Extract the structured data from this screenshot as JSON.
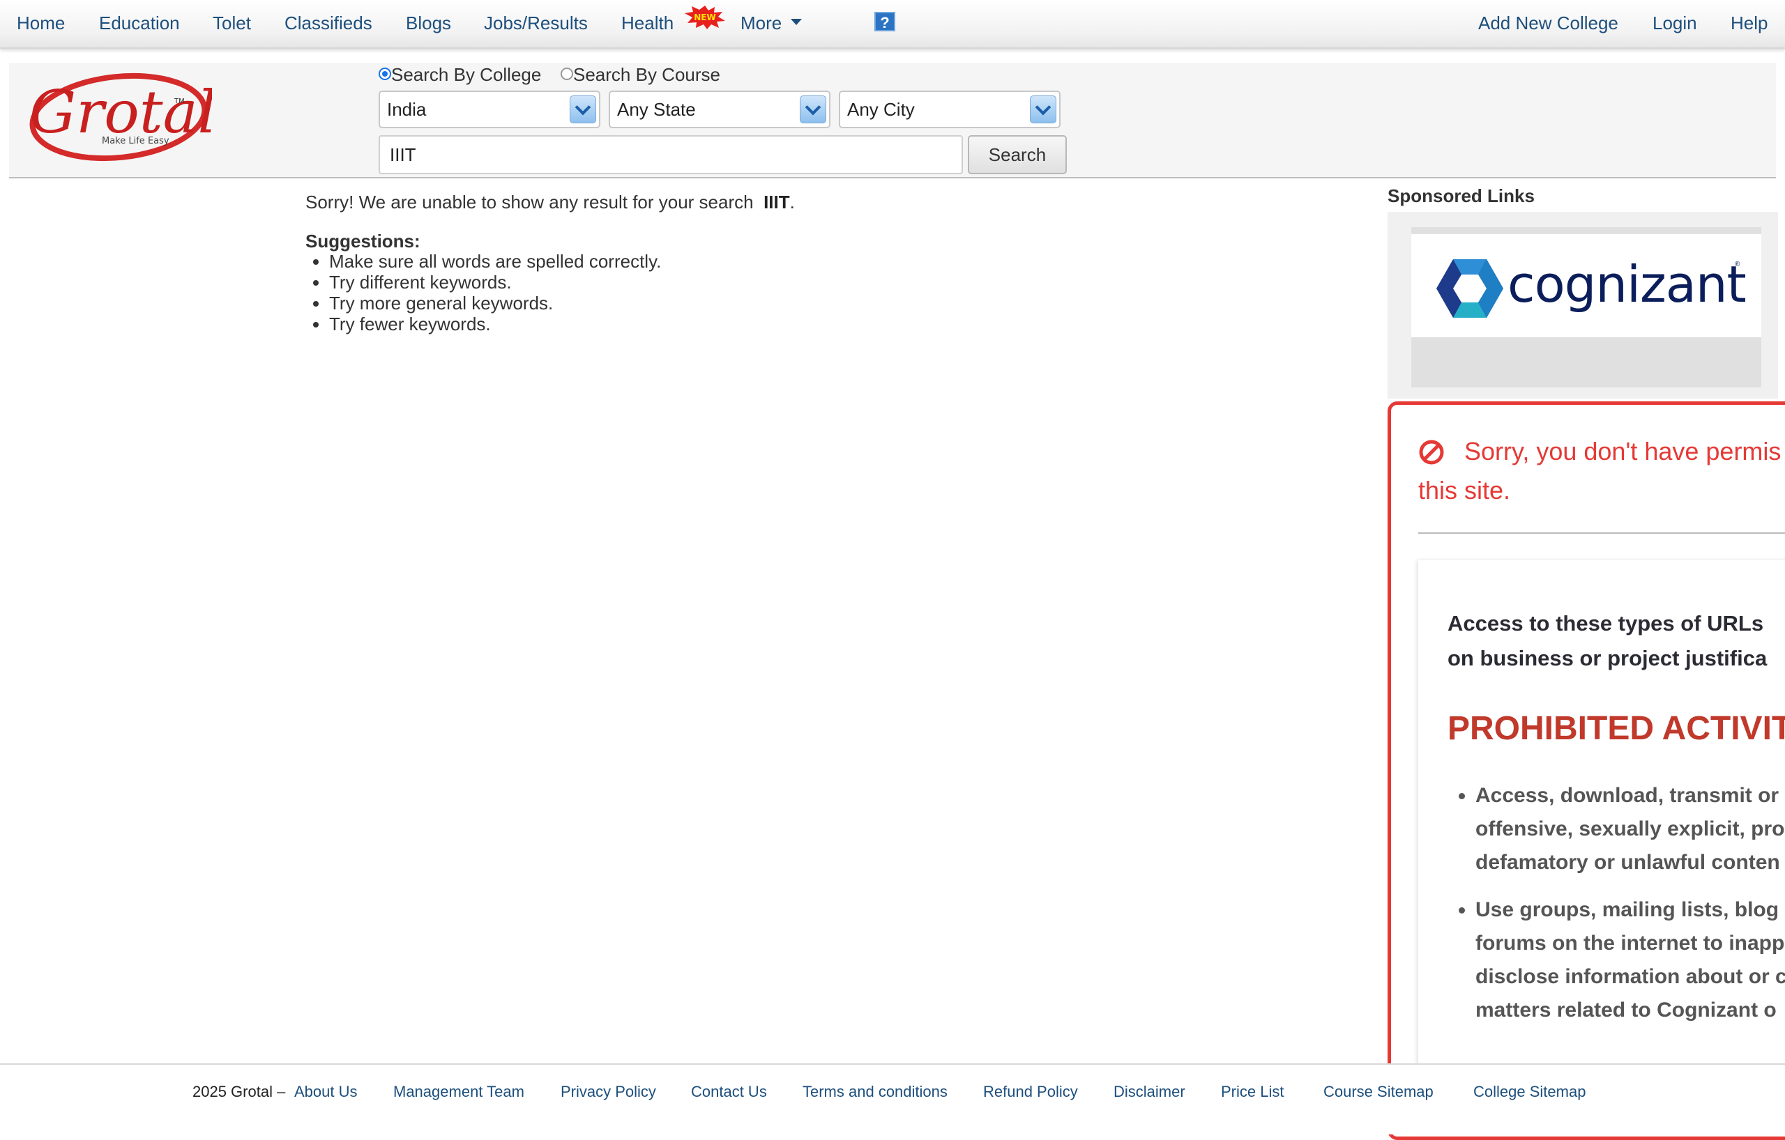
{
  "nav": {
    "home": "Home",
    "education": "Education",
    "tolet": "Tolet",
    "classifieds": "Classifieds",
    "blogs": "Blogs",
    "jobs": "Jobs/Results",
    "health": "Health",
    "new_badge": "NEW",
    "more": "More",
    "help_icon": "?",
    "add_college": "Add New College",
    "login": "Login",
    "help": "Help"
  },
  "logo": {
    "brand": "Grotal",
    "tagline": "Make Life Easy",
    "tm": "TM"
  },
  "search": {
    "by_college": "Search By College",
    "by_course": "Search By Course",
    "country": "India",
    "state": "Any State",
    "city": "Any City",
    "query": "IIIT",
    "button": "Search"
  },
  "results": {
    "message": "Sorry! We are unable to show any result for your search",
    "term": "IIIT",
    "period": ".",
    "suggestions_title": "Suggestions:",
    "suggestions": [
      "Make sure all words are spelled correctly.",
      "Try different keywords.",
      "Try more general keywords.",
      "Try fewer keywords."
    ]
  },
  "sponsored": {
    "title": "Sponsored Links",
    "ad_brand": "cognizant",
    "ad_reg": "®"
  },
  "blocked": {
    "line1": "Sorry, you don't have permis",
    "line2": "this site.",
    "intro_line1": "Access to these types of URLs",
    "intro_line2": "on business or project justifica",
    "heading": "PROHIBITED ACTIVIT",
    "bullet1": [
      "Access, download, transmit or",
      "offensive, sexually explicit, pro",
      "defamatory or unlawful conten"
    ],
    "bullet2": [
      "Use groups, mailing lists, blog",
      "forums on the internet to inapp",
      "disclose information about or c",
      "matters related to Cognizant o"
    ]
  },
  "footer": {
    "copyright": "2025 Grotal –",
    "links": [
      "About Us",
      "Management Team",
      "Privacy Policy",
      "Contact Us",
      "Terms and conditions",
      "Refund Policy",
      "Disclaimer",
      "Price List",
      "Course Sitemap",
      "College Sitemap"
    ]
  },
  "colors": {
    "nav_link": "#1d4f7d",
    "logo_red": "#d42a2a",
    "block_red": "#e53935",
    "heading_red": "#c0392b",
    "radio_blue": "#1a73e8"
  }
}
